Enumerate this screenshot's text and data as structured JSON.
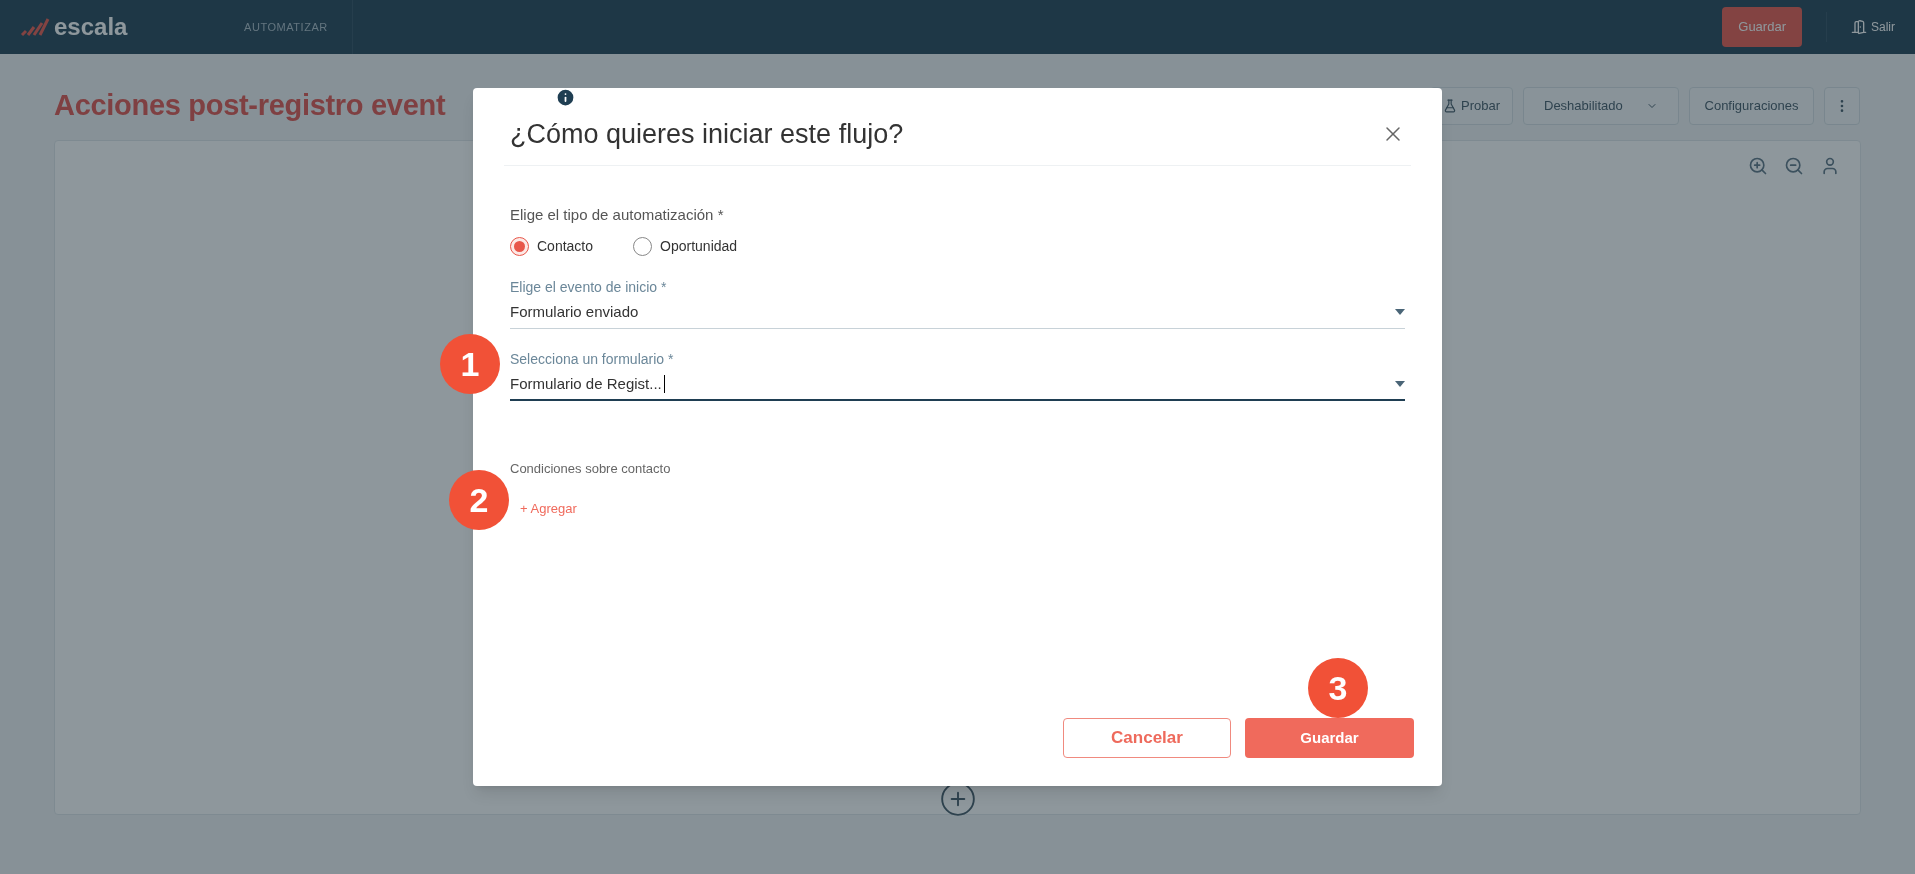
{
  "top_bar": {
    "logo": "escala",
    "nav": [
      {
        "label": "AUTOMATIZAR",
        "selected": false
      }
    ],
    "save_button": "Guardar",
    "exit_link": "Salir"
  },
  "page": {
    "title": "Acciones post-registro event",
    "actions": [
      {
        "kind": "test",
        "label": "Probar"
      },
      {
        "kind": "dropdown",
        "label": "Deshabilitado"
      },
      {
        "kind": "plain",
        "label": "Configuraciones"
      },
      {
        "kind": "more"
      }
    ]
  },
  "dialog": {
    "title": "¿Cómo quieres iniciar este flujo?",
    "type_label": "Elige el tipo de automatización *",
    "options": [
      {
        "label": "Contacto",
        "selected": true
      },
      {
        "label": "Oportunidad",
        "selected": false
      }
    ],
    "selects": [
      {
        "label": "Elige el evento de inicio *",
        "value": "Formulario enviado",
        "focused": false
      },
      {
        "label": "Selecciona un formulario *",
        "value": "Formulario de Regist...",
        "focused": true
      }
    ],
    "conditions_label": "Condiciones sobre contacto",
    "add_link": "+ Agregar",
    "cancel_button": "Cancelar",
    "save_button": "Guardar"
  },
  "step_badges": [
    "1",
    "2",
    "3"
  ]
}
